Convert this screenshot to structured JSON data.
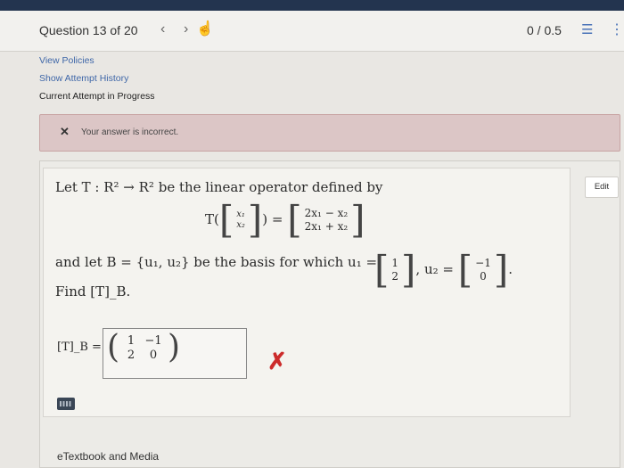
{
  "header": {
    "question_label": "Question 13 of 20",
    "prev_icon": "chevron-left-icon",
    "next_icon": "chevron-right-icon",
    "pointer_icon": "hand-pointer-icon",
    "score": "0 / 0.5",
    "list_icon": "list-icon",
    "more_icon": "more-vertical-icon",
    "accent": "#4a73b8",
    "top_bar_color": "#23344f"
  },
  "links": {
    "view_policies": "View Policies",
    "show_attempt_history": "Show Attempt History",
    "current_attempt": "Current Attempt in Progress"
  },
  "feedback": {
    "icon": "x-icon",
    "text": "Your answer is incorrect."
  },
  "question": {
    "statement_intro": "Let T : R² → R² be the linear operator defined by",
    "definition_lhs": "T(",
    "x1": "x₁",
    "x2": "x₂",
    "definition_mid": ") =",
    "row1": "2x₁ − x₂",
    "row2": "2x₁ + x₂",
    "basis_text": "and let B = {u₁, u₂} be the basis for which u₁ =",
    "u1_top": "1",
    "u1_bottom": "2",
    "u2_label": ", u₂ =",
    "u2_top": "−1",
    "u2_bottom": "0",
    "period": ".",
    "find_text": "Find [T]_B."
  },
  "answer": {
    "label": "[T]_B =",
    "m11": "1",
    "m12": "−1",
    "m21": "2",
    "m22": "0",
    "result_icon": "red-x-icon",
    "result_color": "#cc2b2b"
  },
  "buttons": {
    "edit": "Edit"
  },
  "footer": {
    "keyboard_icon": "keyboard-icon",
    "etextbook": "eTextbook and Media"
  }
}
